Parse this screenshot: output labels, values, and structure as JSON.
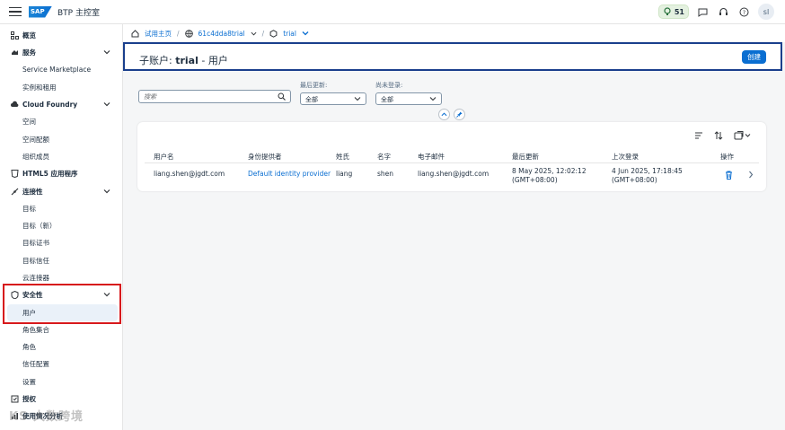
{
  "shell": {
    "title": "BTP 主控室",
    "logo_text": "SAP",
    "points": "51",
    "avatar": "sl"
  },
  "sidebar": {
    "items": [
      {
        "label": "概览",
        "type": "top",
        "icon": "overview-icon"
      },
      {
        "label": "服务",
        "type": "top",
        "icon": "services-icon",
        "expandable": true
      },
      {
        "label": "Service Marketplace",
        "type": "sub"
      },
      {
        "label": "实例和租用",
        "type": "sub"
      },
      {
        "label": "Cloud Foundry",
        "type": "top",
        "icon": "cloud-icon",
        "expandable": true
      },
      {
        "label": "空间",
        "type": "sub"
      },
      {
        "label": "空间配额",
        "type": "sub"
      },
      {
        "label": "组织成员",
        "type": "sub"
      },
      {
        "label": "HTML5 应用程序",
        "type": "top",
        "icon": "html5-icon"
      },
      {
        "label": "连接性",
        "type": "top",
        "icon": "connectivity-icon",
        "expandable": true
      },
      {
        "label": "目标",
        "type": "sub"
      },
      {
        "label": "目标（新）",
        "type": "sub"
      },
      {
        "label": "目标证书",
        "type": "sub"
      },
      {
        "label": "目标信任",
        "type": "sub"
      },
      {
        "label": "云连接器",
        "type": "sub"
      },
      {
        "label": "安全性",
        "type": "top",
        "icon": "shield-icon",
        "expandable": true
      },
      {
        "label": "用户",
        "type": "sub",
        "selected": true
      },
      {
        "label": "角色集合",
        "type": "sub"
      },
      {
        "label": "角色",
        "type": "sub"
      },
      {
        "label": "信任配置",
        "type": "sub"
      },
      {
        "label": "设置",
        "type": "sub"
      },
      {
        "label": "授权",
        "type": "top",
        "icon": "entitlements-icon"
      },
      {
        "label": "使用情况分析",
        "type": "top",
        "icon": "analytics-icon"
      }
    ]
  },
  "breadcrumb": {
    "home": "试用主页",
    "account": "61c4dda8trial",
    "subaccount": "trial"
  },
  "header": {
    "title_prefix": "子账户: ",
    "title_name": "trial",
    "title_suffix": " - 用户",
    "create_label": "创建"
  },
  "filters": {
    "search_placeholder": "搜索",
    "last_updated_label": "最后更新:",
    "last_updated_value": "全部",
    "never_logged_label": "尚未登录:",
    "never_logged_value": "全部"
  },
  "table": {
    "columns": [
      "用户名",
      "身份提供者",
      "姓氏",
      "名字",
      "电子邮件",
      "最后更新",
      "上次登录",
      "操作"
    ],
    "rows": [
      {
        "username": "liang.shen@jgdt.com",
        "idp": "Default identity provider",
        "last_name": "liang",
        "first_name": "shen",
        "email": "liang.shen@jgdt.com",
        "updated_1": "8 May 2025, 12:02:12",
        "updated_2": "(GMT+08:00)",
        "login_1": "4 Jun 2025, 17:18:45",
        "login_2": "(GMT+08:00)"
      }
    ]
  },
  "watermark": "KS 大数跨境",
  "colors": {
    "accent": "#0a6ed1",
    "highlight_box": "#d7191c",
    "header_border": "#1a3f8c"
  }
}
